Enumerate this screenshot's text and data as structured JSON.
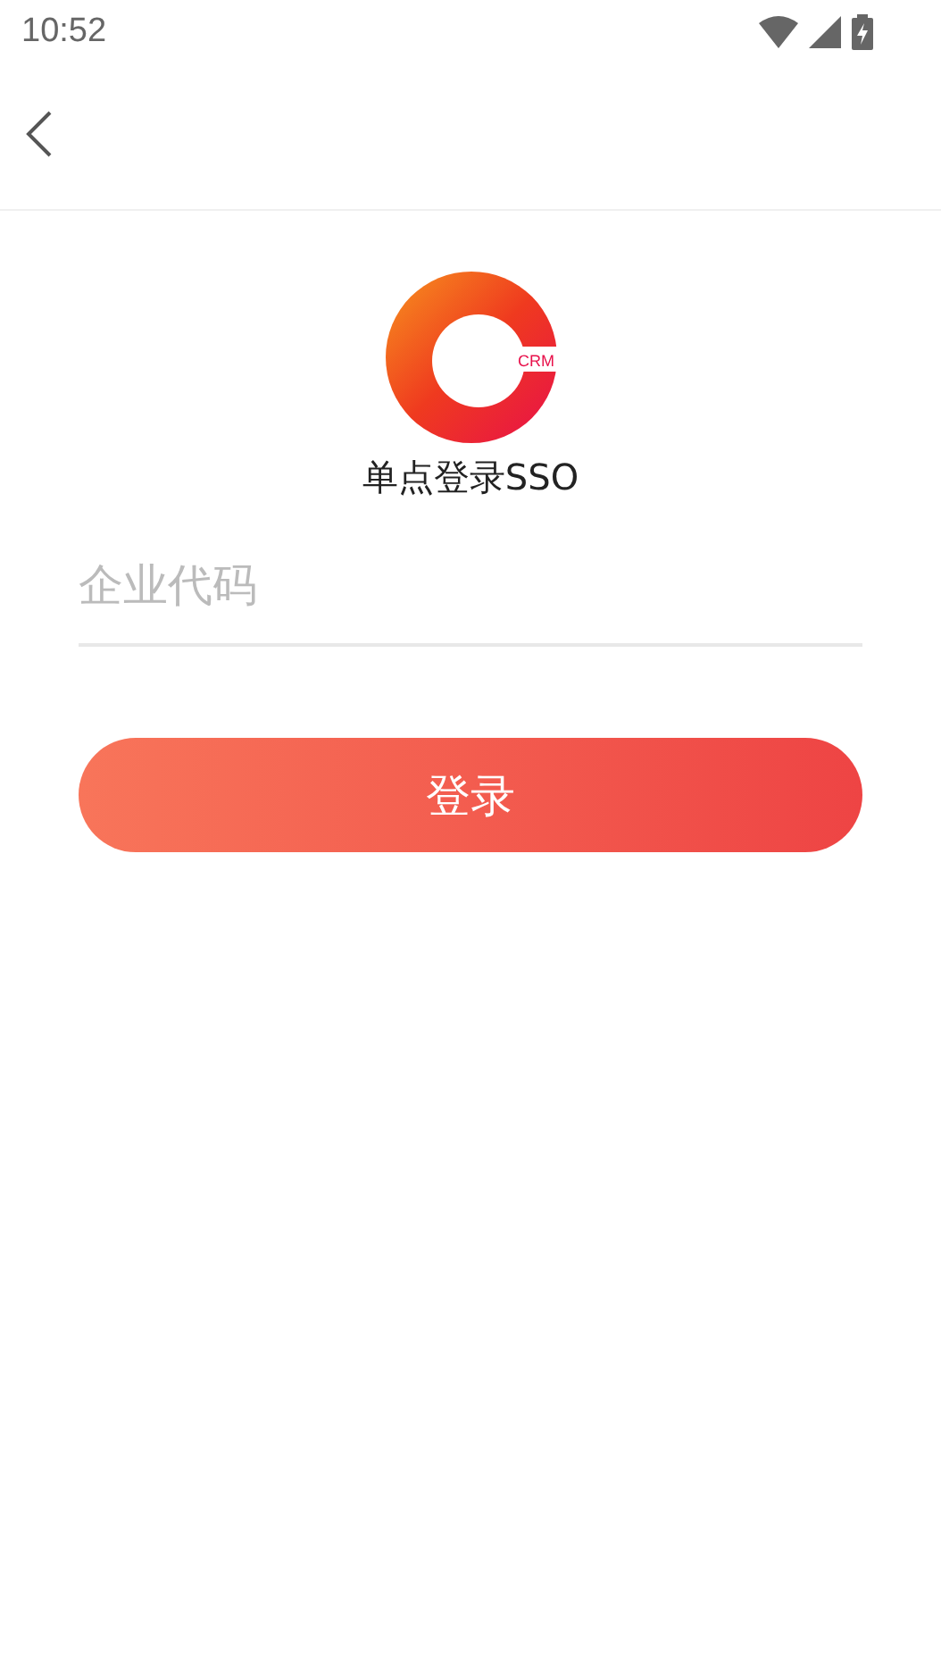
{
  "status_bar": {
    "time": "10:52"
  },
  "logo": {
    "badge": "CRM"
  },
  "title": "单点登录SSO",
  "company_field": {
    "placeholder": "企业代码"
  },
  "login_button": {
    "label": "登录"
  }
}
